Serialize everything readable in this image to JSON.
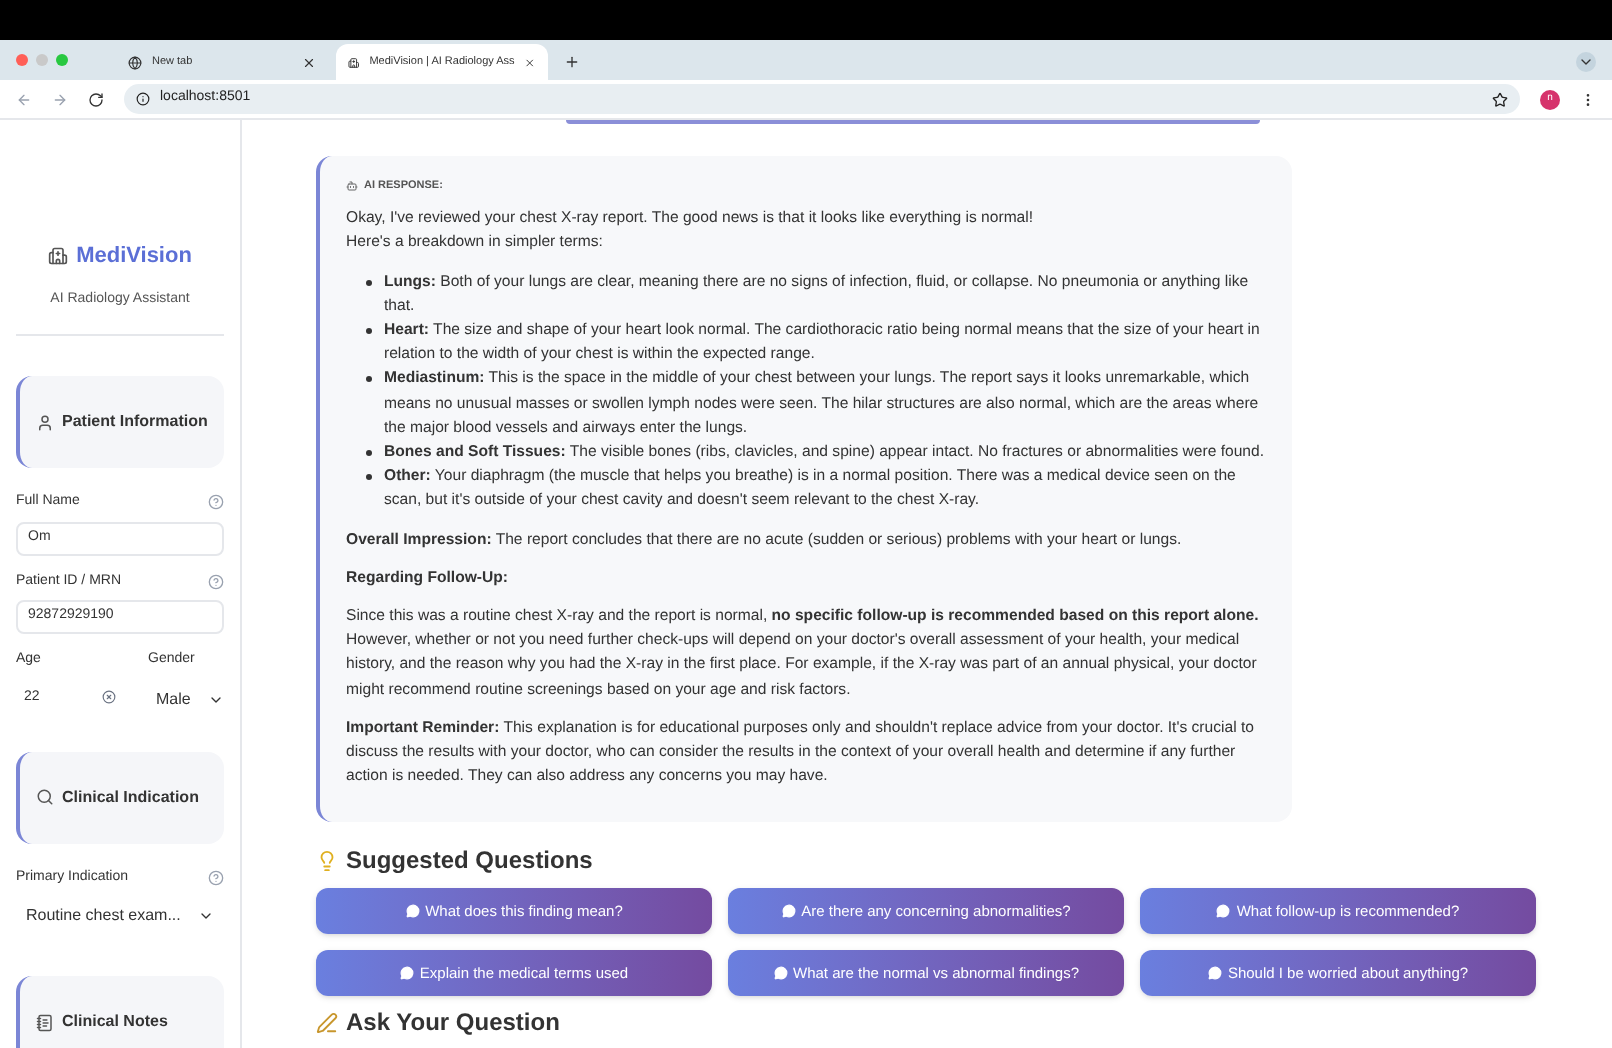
{
  "browser": {
    "tabs": [
      {
        "title": "New tab",
        "selected": false
      },
      {
        "title": "MediVision | AI Radiology Ass",
        "selected": true
      }
    ],
    "address": "localhost:8501",
    "profile": "n"
  },
  "sidebar": {
    "brand": "MediVision",
    "subtitle": "AI Radiology Assistant",
    "items": [
      {
        "kind": "header",
        "title": "Patient Information"
      },
      {
        "kind": "text-field",
        "label": "Full Name",
        "value": "Om"
      },
      {
        "kind": "text-field",
        "label": "Patient ID / MRN",
        "value": "92872929190"
      },
      {
        "kind": "age-gender",
        "age_label": "Age",
        "age": "22",
        "gender_label": "Gender",
        "gender": "Male"
      },
      {
        "kind": "header",
        "title": "Clinical Indication"
      },
      {
        "kind": "select",
        "label": "Primary Indication",
        "value": "Routine chest exam..."
      },
      {
        "kind": "header",
        "title": "Clinical Notes"
      }
    ]
  },
  "response": {
    "label": "AI RESPONSE:",
    "blocks": [
      {
        "kind": "text",
        "lines": [
          "Okay, I've reviewed your chest X-ray report. The good news is that it looks like everything is normal!",
          "Here's a breakdown in simpler terms:"
        ]
      },
      {
        "kind": "list",
        "items": [
          "**Lungs:** Both of your lungs are clear, meaning there are no signs of infection, fluid, or collapse. No pneumonia or anything like that.",
          "**Heart:** The size and shape of your heart look normal. The cardiothoracic ratio being normal means that the size of your heart in relation to the width of your chest is within the expected range.",
          "**Mediastinum:** This is the space in the middle of your chest between your lungs. The report says it looks unremarkable, which means no unusual masses or swollen lymph nodes were seen. The hilar structures are also normal, which are the areas where the major blood vessels and airways enter the lungs.",
          "**Bones and Soft Tissues:** The visible bones (ribs, clavicles, and spine) appear intact. No fractures or abnormalities were found.",
          "**Other:** Your diaphragm (the muscle that helps you breathe) is in a normal position. There was a medical device seen on the scan, but it's outside of your chest cavity and doesn't seem relevant to the chest X-ray."
        ]
      },
      {
        "kind": "text",
        "lines": [
          "**Overall Impression:** The report concludes that there are no acute (sudden or serious) problems with your heart or lungs."
        ]
      },
      {
        "kind": "heading",
        "lines": [
          "Regarding Follow-Up:"
        ]
      },
      {
        "kind": "text",
        "lines": [
          "Since this was a routine chest X-ray and the report is normal, **no specific follow-up is recommended based on this report alone.** However, whether or not you need further check-ups will depend on your doctor's overall assessment of your health, your medical history, and the reason why you had the X-ray in the first place. For example, if the X-ray was part of an annual physical, your doctor might recommend routine screenings based on your age and risk factors."
        ]
      },
      {
        "kind": "text",
        "lines": [
          "**Important Reminder:** This explanation is for educational purposes only and shouldn't replace advice from your doctor. It's crucial to discuss the results with your doctor, who can consider the results in the context of your overall health and determine if any further action is needed. They can also address any concerns you may have."
        ]
      }
    ]
  },
  "suggested": {
    "title": "Suggested Questions",
    "questions": [
      "What does this finding mean?",
      "Are there any concerning abnormalities?",
      "What follow-up is recommended?",
      "Explain the medical terms used",
      "What are the normal vs abnormal findings?",
      "Should I be worried about anything?"
    ]
  },
  "ask": {
    "title": "Ask Your Question"
  }
}
